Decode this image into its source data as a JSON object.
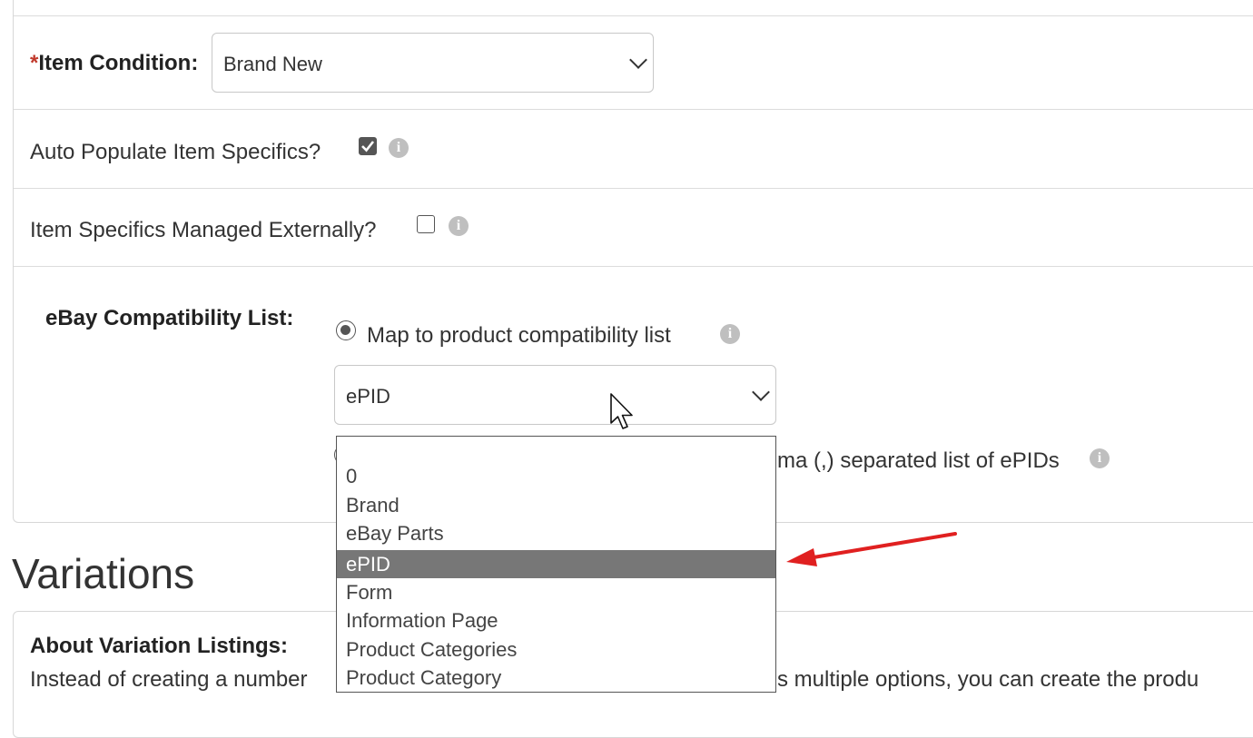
{
  "item_condition": {
    "required_mark": "*",
    "label": "Item Condition:",
    "selected": "Brand New"
  },
  "auto_populate": {
    "label": "Auto Populate Item Specifics?",
    "checked": true
  },
  "managed_externally": {
    "label": "Item Specifics Managed Externally?",
    "checked": false
  },
  "compatibility": {
    "label": "eBay Compatibility List:",
    "radio_map_label": "Map to product compatibility list",
    "select_value": "ePID",
    "radio_comma_label_visible": "ma (,) separated list of ePIDs"
  },
  "dropdown": {
    "options": [
      "",
      "0",
      "Brand",
      "eBay Parts",
      "ePID",
      "Form",
      "Information Page",
      "Product Categories",
      "Product Category"
    ],
    "selected": "ePID"
  },
  "variations": {
    "heading": "Variations",
    "about_title": "About Variation Listings:",
    "about_text_left": "Instead of creating a number",
    "about_text_right": "s multiple options, you can create the produ"
  },
  "icons": {
    "info": "info-icon",
    "arrow": "red-arrow-annotation",
    "cursor": "mouse-cursor"
  },
  "colors": {
    "required": "#c0392b",
    "selected_option_bg": "#777777",
    "arrow": "#e02020"
  }
}
